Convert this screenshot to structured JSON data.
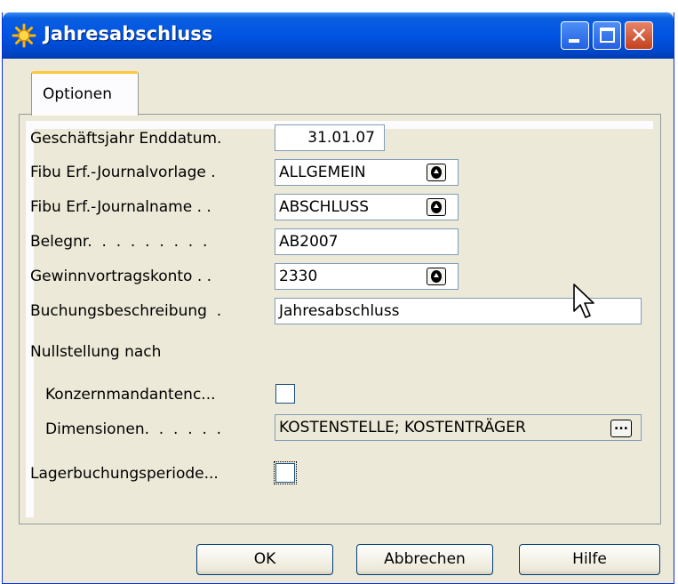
{
  "window": {
    "title": "Jahresabschluss",
    "close_glyph": "✕"
  },
  "tabs": [
    {
      "label": "Optionen",
      "active": true
    }
  ],
  "form": {
    "fiscal_year_end_label": "Geschäftsjahr Enddatum.",
    "fiscal_year_end_value": "31.01.07",
    "journal_template_label": "Fibu Erf.-Journalvorlage .",
    "journal_template_value": "ALLGEMEIN",
    "journal_name_label": "Fibu Erf.-Journalname . .",
    "journal_name_value": "ABSCHLUSS",
    "document_no_label": "Belegnr.  .  .  .  .  .  .  .  .",
    "document_no_value": "AB2007",
    "retained_earnings_label": "Gewinnvortragskonto . .",
    "retained_earnings_value": "2330",
    "posting_description_label": "Buchungsbeschreibung  .",
    "posting_description_value": "Jahresabschluss",
    "close_by_label": "Nullstellung nach",
    "business_unit_label": "Konzernmandantenc...",
    "business_unit_checked": false,
    "dimensions_label": "Dimensionen.  .  .  .  .  .",
    "dimensions_value": "KOSTENSTELLE; KOSTENTRÄGER",
    "assist_glyph": "...",
    "inventory_period_label": "Lagerbuchungsperiode...",
    "inventory_period_checked": false
  },
  "buttons": {
    "ok": "OK",
    "cancel": "Abbrechen",
    "help": "Hilfe"
  }
}
